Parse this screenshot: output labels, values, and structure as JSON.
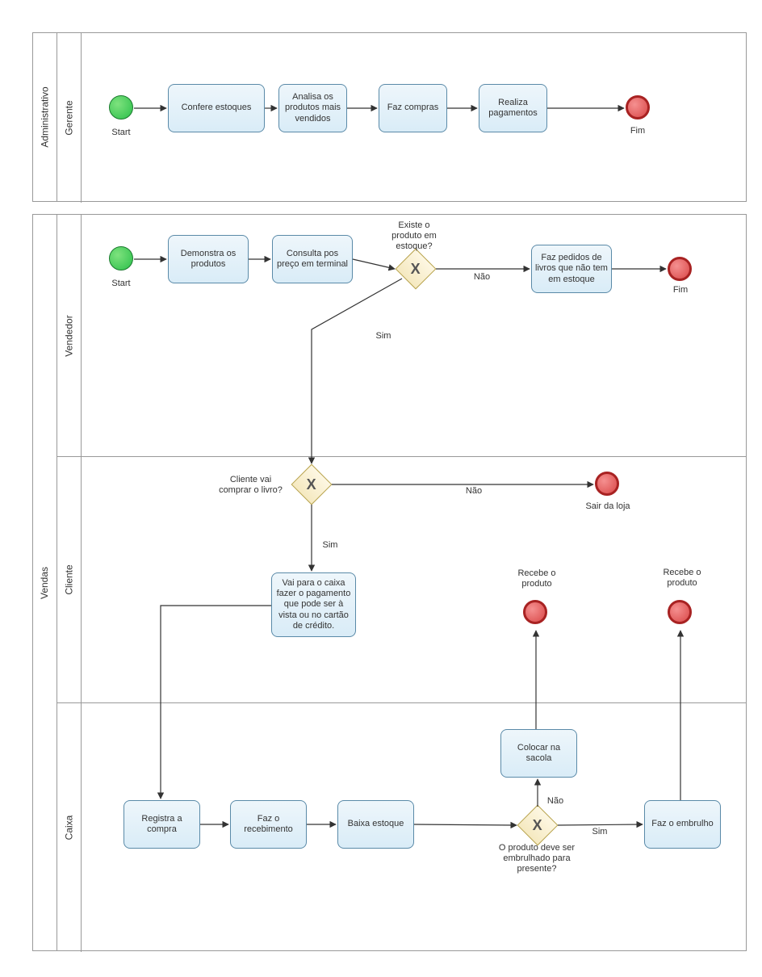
{
  "pools": {
    "admin": {
      "title": "Administrativo"
    },
    "vendas": {
      "title": "Vendas"
    }
  },
  "lanes": {
    "gerente": {
      "title": "Gerente"
    },
    "vendedor": {
      "title": "Vendedor"
    },
    "cliente": {
      "title": "Cliente"
    },
    "caixa": {
      "title": "Caixa"
    }
  },
  "events": {
    "start1_label": "Start",
    "end1_label": "Fim",
    "start2_label": "Start",
    "end2_label": "Fim",
    "end_sair_label": "Sair da loja",
    "end_recebe1_label": "Recebe o produto",
    "end_recebe2_label": "Recebe o produto"
  },
  "tasks": {
    "confere": "Confere estoques",
    "analisa": "Analisa os produtos mais vendidos",
    "compras": "Faz compras",
    "pagamentos": "Realiza pagamentos",
    "demonstra": "Demonstra os produtos",
    "consulta": "Consulta pos preço em terminal",
    "pedidos": "Faz pedidos de livros que não tem em estoque",
    "vai_caixa": "Vai para o caixa fazer o pagamento que pode ser à vista ou no cartão de crédito.",
    "registra": "Registra a compra",
    "recebimento": "Faz o recebimento",
    "baixa": "Baixa estoque",
    "sacola": "Colocar na sacola",
    "embrulho": "Faz o embrulho"
  },
  "gateways": {
    "g_estoque": {
      "question": "Existe o produto em estoque?",
      "yes": "Sim",
      "no": "Não"
    },
    "g_comprar": {
      "question": "Cliente vai comprar o livro?",
      "yes": "Sim",
      "no": "Não"
    },
    "g_embrulho": {
      "question": "O produto deve ser embrulhado para presente?",
      "yes": "Sim",
      "no": "Não"
    }
  }
}
